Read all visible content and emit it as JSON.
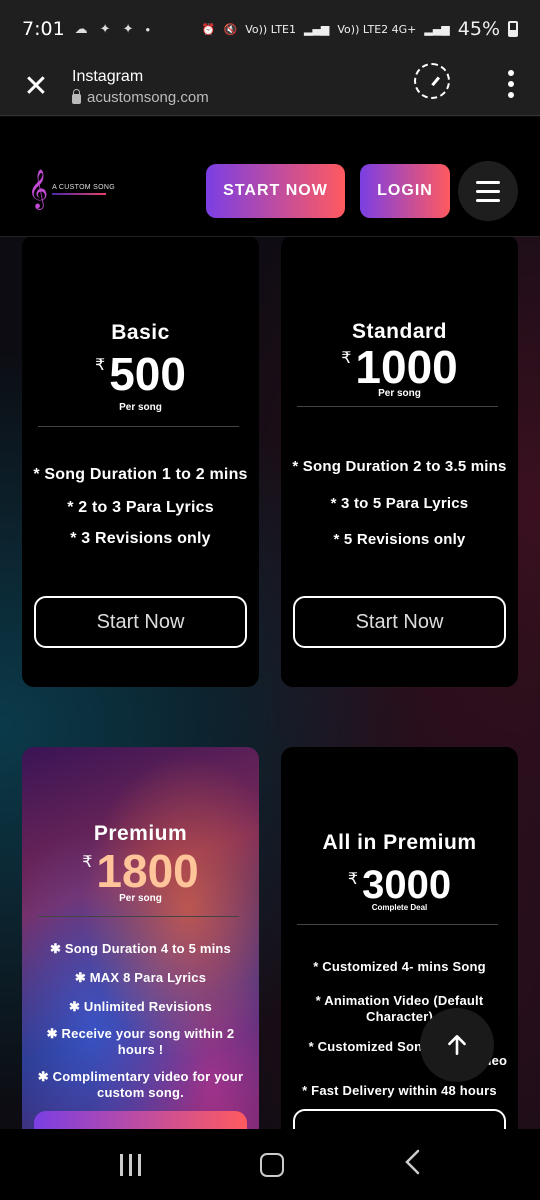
{
  "status_bar": {
    "time": "7:01",
    "left_icons": [
      "cloud-icon",
      "notification-icon",
      "notification-icon",
      "dot-icon"
    ],
    "network_1": "Vo)) LTE1",
    "network_2": "Vo)) LTE2 4G+",
    "battery": "45%"
  },
  "browser": {
    "title": "Instagram",
    "url": "acustomsong.com"
  },
  "header": {
    "logo_text": "A CUSTOM SONG",
    "start_now": "START NOW",
    "login": "LOGIN"
  },
  "currency": "₹",
  "plans": [
    {
      "name": "Basic",
      "price": "500",
      "per": "Per song",
      "features": [
        "* Song Duration 1 to 2 mins",
        "* 2 to 3 Para Lyrics",
        "* 3 Revisions only"
      ],
      "button": "Start Now"
    },
    {
      "name": "Standard",
      "price": "1000",
      "per": "Per song",
      "features": [
        "* Song Duration 2 to 3.5 mins",
        "* 3 to 5 Para Lyrics",
        "* 5 Revisions only"
      ],
      "button": "Start Now"
    },
    {
      "name": "Premium",
      "price": "1800",
      "per": "Per song",
      "features": [
        "✱ Song Duration 4 to 5 mins",
        "✱ MAX 8 Para Lyrics",
        "✱ Unlimited Revisions",
        "✱ Receive your song within 2 hours !",
        "✱ Complimentary video for your custom song."
      ]
    },
    {
      "name": "All in Premium",
      "price": "3000",
      "per": "Complete Deal",
      "features": [
        "* Customized 4- mins Song",
        "* Animation Video (Default Character)",
        "* Customized Song",
        "lly Video",
        "* Fast Delivery within 48 hours"
      ]
    }
  ],
  "colors": {
    "accent_start": "#7b3fe4",
    "accent_end": "#ff5a5f",
    "premium_price": "#ffc49a"
  }
}
